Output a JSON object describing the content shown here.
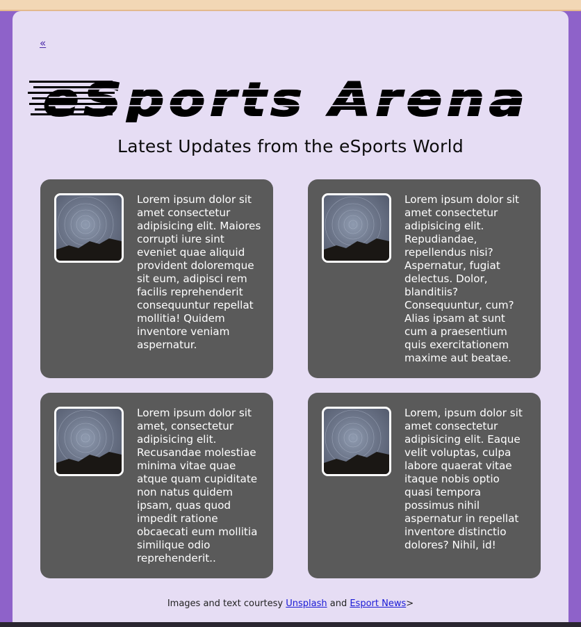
{
  "nav": {
    "back_label": "«"
  },
  "header": {
    "logo_text": "eSports Arena",
    "subtitle": "Latest Updates from the eSports World"
  },
  "cards": [
    {
      "text": "Lorem ipsum dolor sit amet consectetur adipisicing elit. Maiores corrupti iure sint eveniet quae aliquid provident doloremque sit eum, adipisci rem facilis reprehenderit consequuntur repellat mollitia! Quidem inventore veniam aspernatur."
    },
    {
      "text": "Lorem ipsum dolor sit amet consectetur adipisicing elit. Repudiandae, repellendus nisi? Aspernatur, fugiat delectus. Dolor, blanditiis? Consequuntur, cum? Alias ipsam at sunt cum a praesentium quis exercitationem maxime aut beatae."
    },
    {
      "text": "Lorem ipsum dolor sit amet, consectetur adipisicing elit. Recusandae molestiae minima vitae quae atque quam cupiditate non natus quidem ipsam, quas quod impedit ratione obcaecati eum mollitia similique odio reprehenderit.."
    },
    {
      "text": "Lorem, ipsum dolor sit amet consectetur adipisicing elit. Eaque velit voluptas, culpa labore quaerat vitae itaque nobis optio quasi tempora possimus nihil aspernatur in repellat inventore distinctio dolores? Nihil, id!"
    }
  ],
  "footer": {
    "prefix": "Images and text courtesy ",
    "link1": "Unsplash",
    "middle": " and ",
    "link2": "Esport News",
    "suffix": ">"
  },
  "colors": {
    "page_background": "#8e62c9",
    "panel": "#e6ddf4",
    "card": "#5a5a5a",
    "link": "#1a1ad6"
  }
}
